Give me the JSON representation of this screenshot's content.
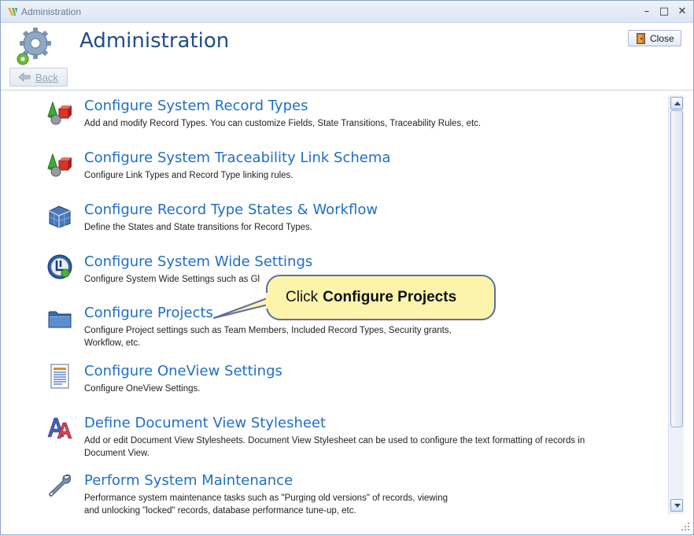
{
  "window": {
    "title": "Administration",
    "minimize_glyph": "–",
    "maximize_glyph": "□",
    "close_glyph": "✕"
  },
  "header": {
    "page_title": "Administration",
    "close_label": "Close",
    "back_label": "Back"
  },
  "items": [
    {
      "title": "Configure System Record Types",
      "description": "Add and modify Record Types. You can customize Fields, State Transitions, Traceability Rules, etc.",
      "icon": "shapes-icon"
    },
    {
      "title": "Configure System Traceability Link Schema",
      "description": "Configure Link Types and Record Type linking rules.",
      "icon": "shapes-icon"
    },
    {
      "title": "Configure Record Type States & Workflow",
      "description": "Define the States and State transitions for Record Types.",
      "icon": "cubes-icon"
    },
    {
      "title": "Configure System Wide Settings",
      "description": "Configure System Wide Settings such as Gl",
      "icon": "settings-globe-icon"
    },
    {
      "title": "Configure Projects",
      "description": "Configure Project  settings such as Team Members, Included Record Types, Security grants, Workflow, etc.",
      "icon": "folder-icon"
    },
    {
      "title": "Configure OneView Settings",
      "description": "Configure OneView Settings.",
      "icon": "document-icon"
    },
    {
      "title": "Define Document View Stylesheet",
      "description": "Add or edit Document View Stylesheets.  Document View Stylesheet can be used to configure the text formatting of records in Document View.",
      "icon": "font-style-icon"
    },
    {
      "title": "Perform System Maintenance",
      "description": "Performance system maintenance tasks such as \"Purging old versions\" of records, viewing and unlocking \"locked\" records, database performance tune-up, etc.",
      "icon": "wrench-icon"
    }
  ],
  "callout": {
    "prefix": "Click",
    "bold": "Configure Projects"
  },
  "colors": {
    "title_blue": "#1f4e8a",
    "link_blue": "#1f6fc7",
    "callout_fill": "#fdf4ac",
    "callout_border": "#5c6ea0"
  }
}
